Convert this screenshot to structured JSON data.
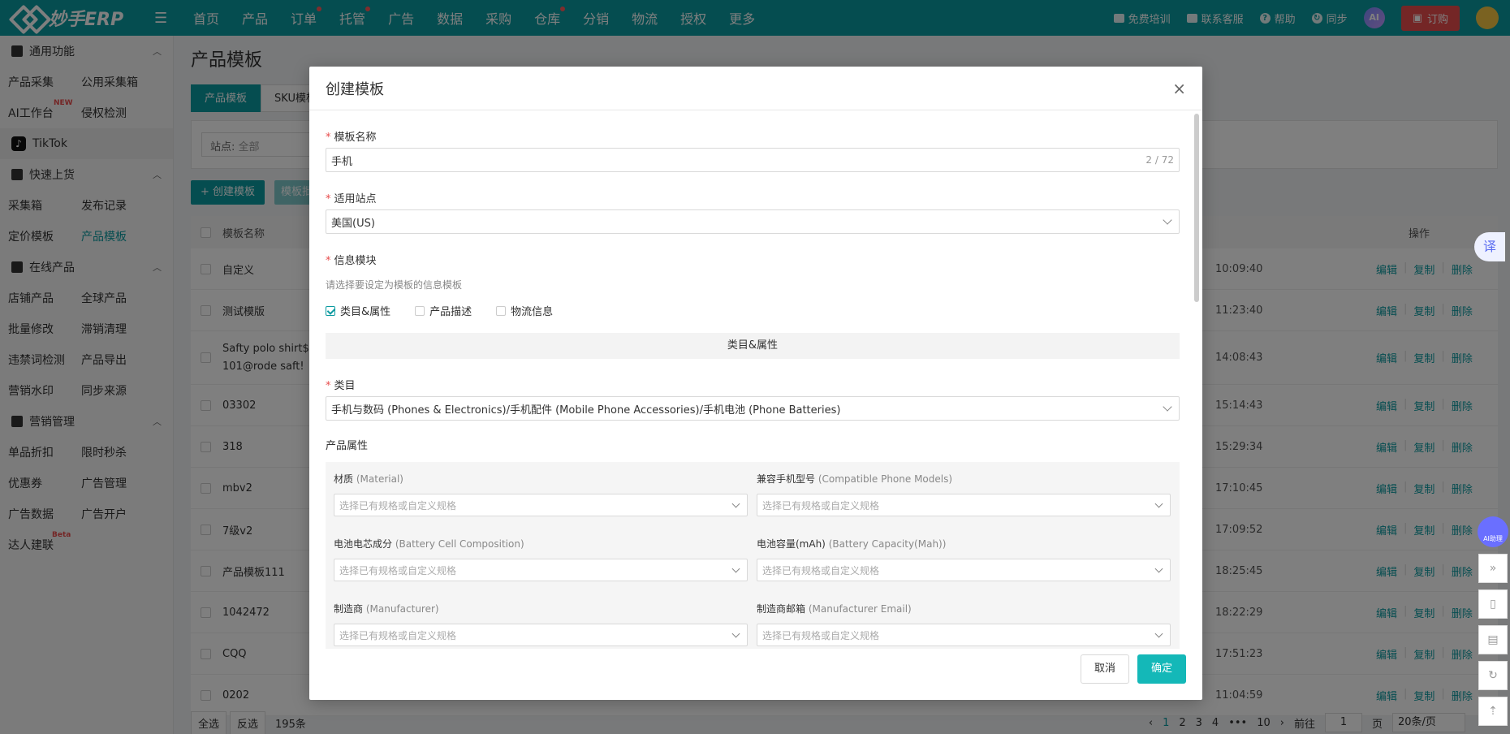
{
  "app": {
    "logo_text": "妙手ERP"
  },
  "topnav": [
    "首页",
    "产品",
    "订单",
    "托管",
    "广告",
    "数据",
    "采购",
    "仓库",
    "分销",
    "物流",
    "授权",
    "更多"
  ],
  "topnav_dots": [
    2,
    3,
    7
  ],
  "topright": {
    "training": "免费培训",
    "support": "联系客服",
    "help": "帮助",
    "sync": "同步",
    "ai": "AI",
    "order": "订购"
  },
  "sidebar": {
    "group1": "通用功能",
    "rows1": [
      [
        "产品采集",
        "公用采集箱"
      ],
      [
        "AI工作台",
        "侵权检测"
      ]
    ],
    "new_badge": "NEW",
    "tiktok": "TikTok",
    "group2": "快速上货",
    "rows2": [
      [
        "采集箱",
        "发布记录"
      ],
      [
        "定价模板",
        "产品模板"
      ]
    ],
    "group3": "在线产品",
    "rows3": [
      [
        "店铺产品",
        "全球产品"
      ],
      [
        "批量修改",
        "滞销清理"
      ],
      [
        "违禁词检测",
        "产品导出"
      ],
      [
        "营销水印",
        "同步来源"
      ]
    ],
    "group4": "营销管理",
    "rows4": [
      [
        "单品折扣",
        "限时秒杀"
      ],
      [
        "优惠券",
        "广告管理"
      ],
      [
        "广告数据",
        "广告开户"
      ],
      [
        "达人建联",
        ""
      ]
    ],
    "beta_badge": "Beta"
  },
  "main": {
    "title": "产品模板",
    "tabs": [
      "产品模板",
      "SKU模板"
    ],
    "filter_label": "站点:",
    "filter_value": "全部",
    "create_btn": "+ 创建模板",
    "batch_btn": "模板批",
    "col_name": "模板名称",
    "col_ops": "操作",
    "rows": [
      {
        "name": "自定义",
        "time": "10:09:40"
      },
      {
        "name": "测试模版",
        "time": "11:23:40"
      },
      {
        "name": "Safty polo shirt$ 101@rode saft!",
        "time": "14:08:43"
      },
      {
        "name": "03302",
        "time": "15:14:43"
      },
      {
        "name": "318",
        "time": "15:29:34"
      },
      {
        "name": "mbv2",
        "time": "17:10:45"
      },
      {
        "name": "7级v2",
        "time": "17:09:52"
      },
      {
        "name": "产品模板111",
        "time": "18:25:45"
      },
      {
        "name": "1042472",
        "time": "18:22:29"
      },
      {
        "name": "CQQ",
        "time": "17:51:23"
      },
      {
        "name": "0202",
        "time": "11:04:59"
      }
    ],
    "ops": {
      "edit": "编辑",
      "copy": "复制",
      "delete": "删除"
    },
    "footer": {
      "select_all": "全选",
      "invert": "反选",
      "count": "195条"
    },
    "pager": {
      "pages": [
        "1",
        "2",
        "3",
        "4",
        "•••",
        "10"
      ],
      "goto": "前往",
      "page_val": "1",
      "page_unit": "页",
      "size": "20条/页"
    }
  },
  "right_tools": {
    "translate": "译",
    "ai_help": "AI助理"
  },
  "modal": {
    "title": "创建模板",
    "name_label": "模板名称",
    "name_value": "手机",
    "name_count": "2 / 72",
    "site_label": "适用站点",
    "site_value": "美国(US)",
    "module_label": "信息模块",
    "module_hint": "请选择要设定为模板的信息模板",
    "modules": [
      {
        "label": "类目&属性",
        "checked": true
      },
      {
        "label": "产品描述",
        "checked": false
      },
      {
        "label": "物流信息",
        "checked": false
      }
    ],
    "section_title": "类目&属性",
    "category_label": "类目",
    "category_value": "手机与数码 (Phones & Electronics)/手机配件 (Mobile Phone Accessories)/手机电池 (Phone Batteries)",
    "attr_title": "产品属性",
    "attr_placeholder": "选择已有规格或自定义规格",
    "attrs": [
      {
        "cn": "材质",
        "en": "(Material)"
      },
      {
        "cn": "兼容手机型号",
        "en": "(Compatible Phone Models)"
      },
      {
        "cn": "电池电芯成分",
        "en": "(Battery Cell Composition)"
      },
      {
        "cn": "电池容量(mAh)",
        "en": "(Battery Capacity(Mah))"
      },
      {
        "cn": "制造商",
        "en": "(Manufacturer)"
      },
      {
        "cn": "制造商邮箱",
        "en": "(Manufacturer Email)"
      }
    ],
    "cancel": "取消",
    "confirm": "确定"
  }
}
